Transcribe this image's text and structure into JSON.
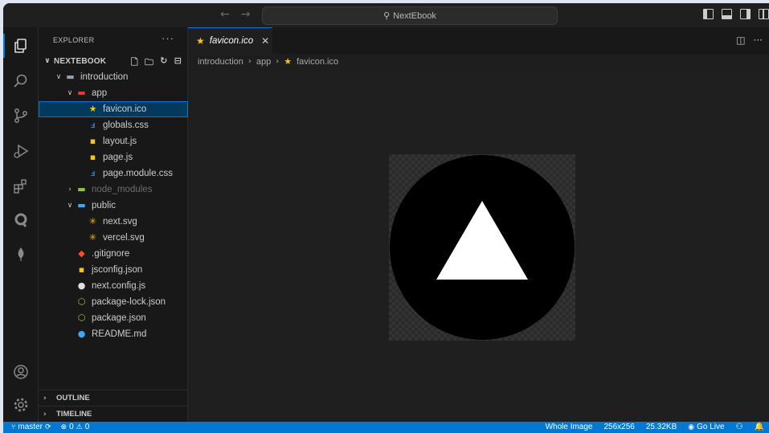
{
  "titlebar": {
    "search_text": "NextEbook",
    "back_icon": "arrow-left-icon",
    "forward_icon": "arrow-right-icon"
  },
  "sidebar": {
    "title": "EXPLORER",
    "more": "···",
    "root": "NEXTEBOOK",
    "tree": [
      {
        "label": "introduction",
        "depth": 1,
        "type": "folder-open",
        "icon": "folder-icon"
      },
      {
        "label": "app",
        "depth": 2,
        "type": "folder-open",
        "icon": "app-folder-icon"
      },
      {
        "label": "favicon.ico",
        "depth": 3,
        "type": "file",
        "icon": "star-icon",
        "selected": true
      },
      {
        "label": "globals.css",
        "depth": 3,
        "type": "file",
        "icon": "css-icon"
      },
      {
        "label": "layout.js",
        "depth": 3,
        "type": "file",
        "icon": "js-icon"
      },
      {
        "label": "page.js",
        "depth": 3,
        "type": "file",
        "icon": "js-icon"
      },
      {
        "label": "page.module.css",
        "depth": 3,
        "type": "file",
        "icon": "css-icon"
      },
      {
        "label": "node_modules",
        "depth": 2,
        "type": "folder-closed",
        "icon": "node-folder-icon",
        "dim": true
      },
      {
        "label": "public",
        "depth": 2,
        "type": "folder-open",
        "icon": "public-folder-icon"
      },
      {
        "label": "next.svg",
        "depth": 3,
        "type": "file",
        "icon": "svg-icon"
      },
      {
        "label": "vercel.svg",
        "depth": 3,
        "type": "file",
        "icon": "svg-icon"
      },
      {
        "label": ".gitignore",
        "depth": 2,
        "type": "file",
        "icon": "git-icon"
      },
      {
        "label": "jsconfig.json",
        "depth": 2,
        "type": "file",
        "icon": "js-icon"
      },
      {
        "label": "next.config.js",
        "depth": 2,
        "type": "file",
        "icon": "next-icon"
      },
      {
        "label": "package-lock.json",
        "depth": 2,
        "type": "file",
        "icon": "npm-icon"
      },
      {
        "label": "package.json",
        "depth": 2,
        "type": "file",
        "icon": "npm-icon"
      },
      {
        "label": "README.md",
        "depth": 2,
        "type": "file",
        "icon": "info-icon"
      }
    ],
    "outline": "OUTLINE",
    "timeline": "TIMELINE"
  },
  "editor": {
    "tab_label": "favicon.ico",
    "breadcrumb": [
      "introduction",
      "app",
      "favicon.ico"
    ]
  },
  "status": {
    "branch": "master",
    "errors": "0",
    "warnings": "0",
    "image_mode": "Whole Image",
    "dimensions": "256x256",
    "size": "25.32KB",
    "go_live": "Go Live"
  },
  "colors": {
    "accent": "#0078d4",
    "selection": "#04395e",
    "star": "#f5c518"
  }
}
